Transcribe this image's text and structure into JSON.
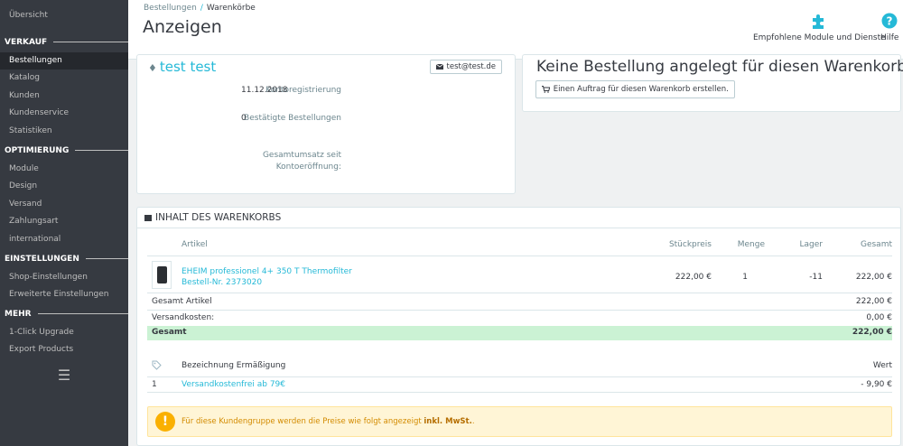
{
  "sidebar": {
    "overview": "Übersicht",
    "sections": [
      {
        "title": "VERKAUF",
        "items": [
          "Bestellungen",
          "Katalog",
          "Kunden",
          "Kundenservice",
          "Statistiken"
        ]
      },
      {
        "title": "OPTIMIERUNG",
        "items": [
          "Module",
          "Design",
          "Versand",
          "Zahlungsart",
          "international"
        ]
      },
      {
        "title": "EINSTELLUNGEN",
        "items": [
          "Shop-Einstellungen",
          "Erweiterte Einstellungen"
        ]
      },
      {
        "title": "MEHR",
        "items": [
          "1-Click Upgrade",
          "Export Products"
        ]
      }
    ],
    "active_item": "Bestellungen",
    "menu_glyph": "☰"
  },
  "header": {
    "breadcrumb_parent": "Bestellungen",
    "breadcrumb_sep": "/",
    "breadcrumb_current": "Warenkörbe",
    "title": "Anzeigen",
    "modules_label": "Empfohlene Module und Dienste",
    "help_label": "Hilfe"
  },
  "customer": {
    "name": "test test",
    "email": "test@test.de",
    "fields": [
      {
        "label": "Kontoregistrierung",
        "value": "11.12.2018"
      },
      {
        "label": "Bestätigte Bestellungen",
        "value": "0"
      },
      {
        "label": "Gesamtumsatz seit Kontoeröffnung:",
        "value": ""
      }
    ]
  },
  "order": {
    "title": "Keine Bestellung angelegt für diesen Warenkorb",
    "create_button": "Einen Auftrag für diesen Warenkorb erstellen."
  },
  "cart": {
    "title": "INHALT DES WARENKORBS",
    "columns": {
      "article": "Artikel",
      "unit_price": "Stückpreis",
      "qty": "Menge",
      "stock": "Lager",
      "total": "Gesamt"
    },
    "product": {
      "name": "EHEIM professionel 4+ 350 T Thermofilter",
      "ref": "Bestell-Nr. 2373020",
      "unit_price": "222,00 €",
      "qty": "1",
      "stock": "-11",
      "total": "222,00 €"
    },
    "summary": [
      {
        "label": "Gesamt Artikel",
        "value": "222,00 €"
      },
      {
        "label": "Versandkosten:",
        "value": "0,00 €"
      }
    ],
    "grand_total": {
      "label": "Gesamt",
      "value": "222,00 €"
    },
    "discounts": {
      "col_name": "Bezeichnung Ermäßigung",
      "col_value": "Wert",
      "rows": [
        {
          "index": "1",
          "name": "Versandkostenfrei ab 79€",
          "value": "- 9,90 €"
        }
      ]
    },
    "notice_prefix": "Für diese Kundengruppe werden die Preise wie folgt angezeigt",
    "notice_bold": "inkl. MwSt."
  }
}
